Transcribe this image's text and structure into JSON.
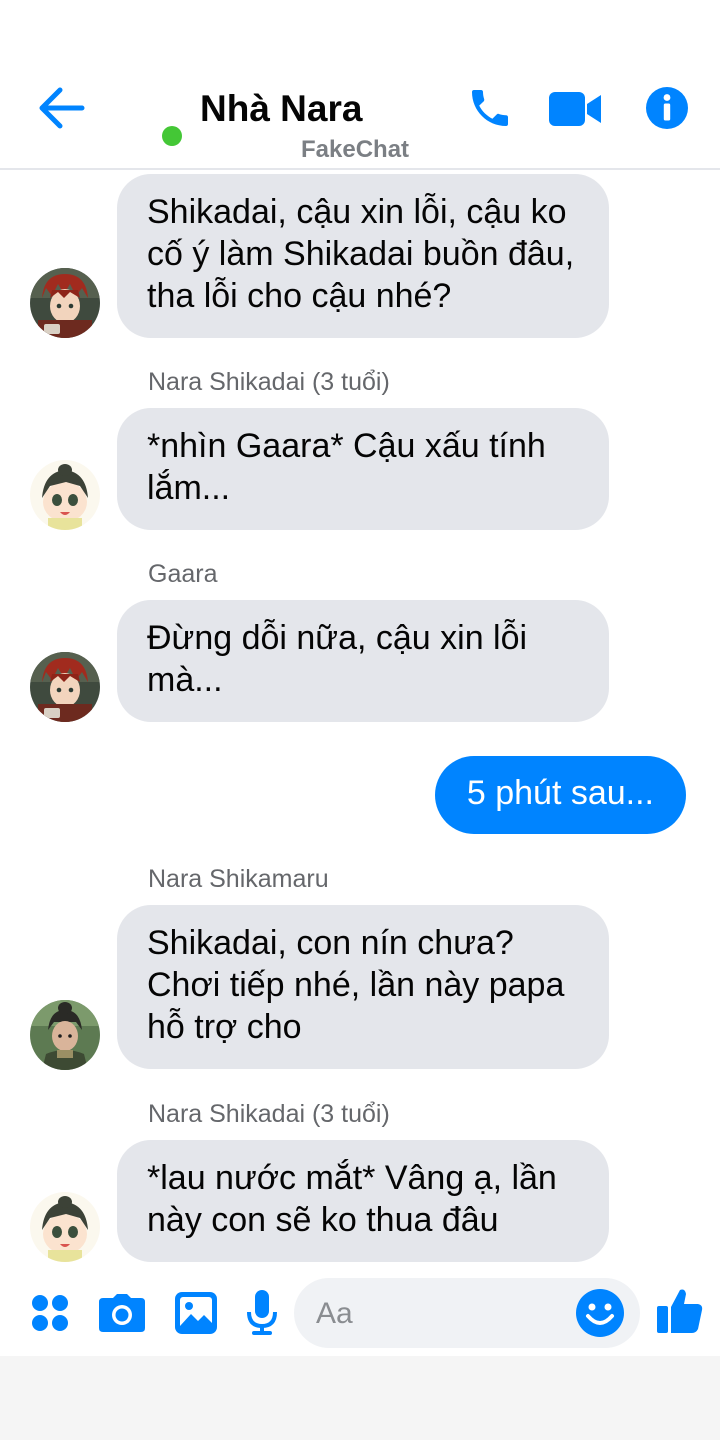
{
  "header": {
    "title": "Nhà Nara",
    "subtitle": "FakeChat",
    "back_icon": "arrow-left-icon",
    "call_icon": "phone-icon",
    "video_icon": "video-camera-icon",
    "info_icon": "info-icon",
    "accent_color": "#0084ff",
    "online_color": "#44c736"
  },
  "messages": [
    {
      "text": "Shikadai, cậu xin lỗi, cậu ko cố ý làm Shikadai buồn đâu, tha lỗi cho cậu nhé?"
    },
    {
      "sender": "Nara Shikadai (3 tuổi)",
      "text": "*nhìn Gaara* Cậu xấu tính lắm..."
    },
    {
      "sender": "Gaara",
      "text": "Đừng dỗi nữa, cậu xin lỗi mà..."
    },
    {
      "text": "5 phút sau...",
      "outgoing": true
    },
    {
      "sender": "Nara Shikamaru",
      "text": "Shikadai, con nín chưa? Chơi tiếp nhé, lần này papa hỗ trợ cho"
    },
    {
      "sender": "Nara Shikadai (3 tuổi)",
      "text": "*lau nước mắt* Vâng ạ, lần này con sẽ ko thua đâu"
    }
  ],
  "composer": {
    "placeholder": "Aa",
    "icons": [
      "apps-icon",
      "camera-icon",
      "image-icon",
      "microphone-icon",
      "emoji-icon",
      "thumbs-up-icon"
    ]
  }
}
